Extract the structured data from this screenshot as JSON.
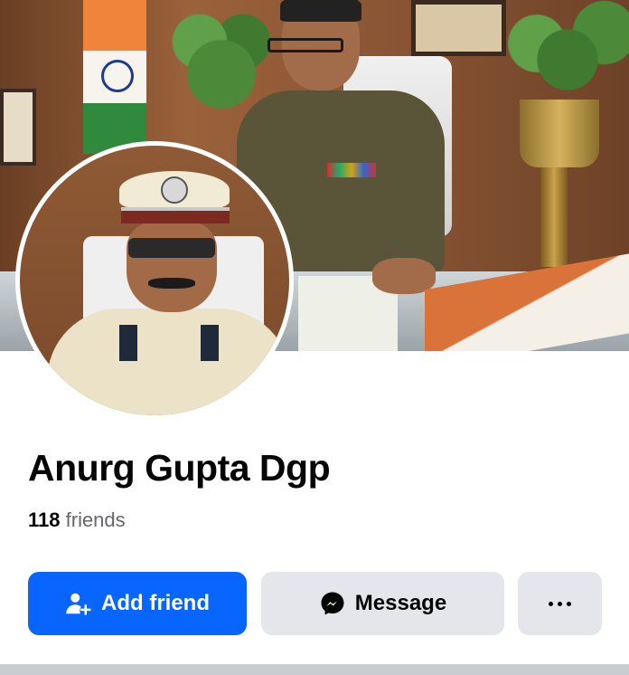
{
  "profile": {
    "name": "Anurg Gupta Dgp",
    "friends_count": "118",
    "friends_label": "friends"
  },
  "actions": {
    "add_friend_label": "Add friend",
    "message_label": "Message",
    "more_icon": "more-horizontal-icon"
  },
  "colors": {
    "primary": "#0866ff",
    "secondary_bg": "#e4e6eb",
    "text": "#050505",
    "muted_text": "#65676b"
  }
}
